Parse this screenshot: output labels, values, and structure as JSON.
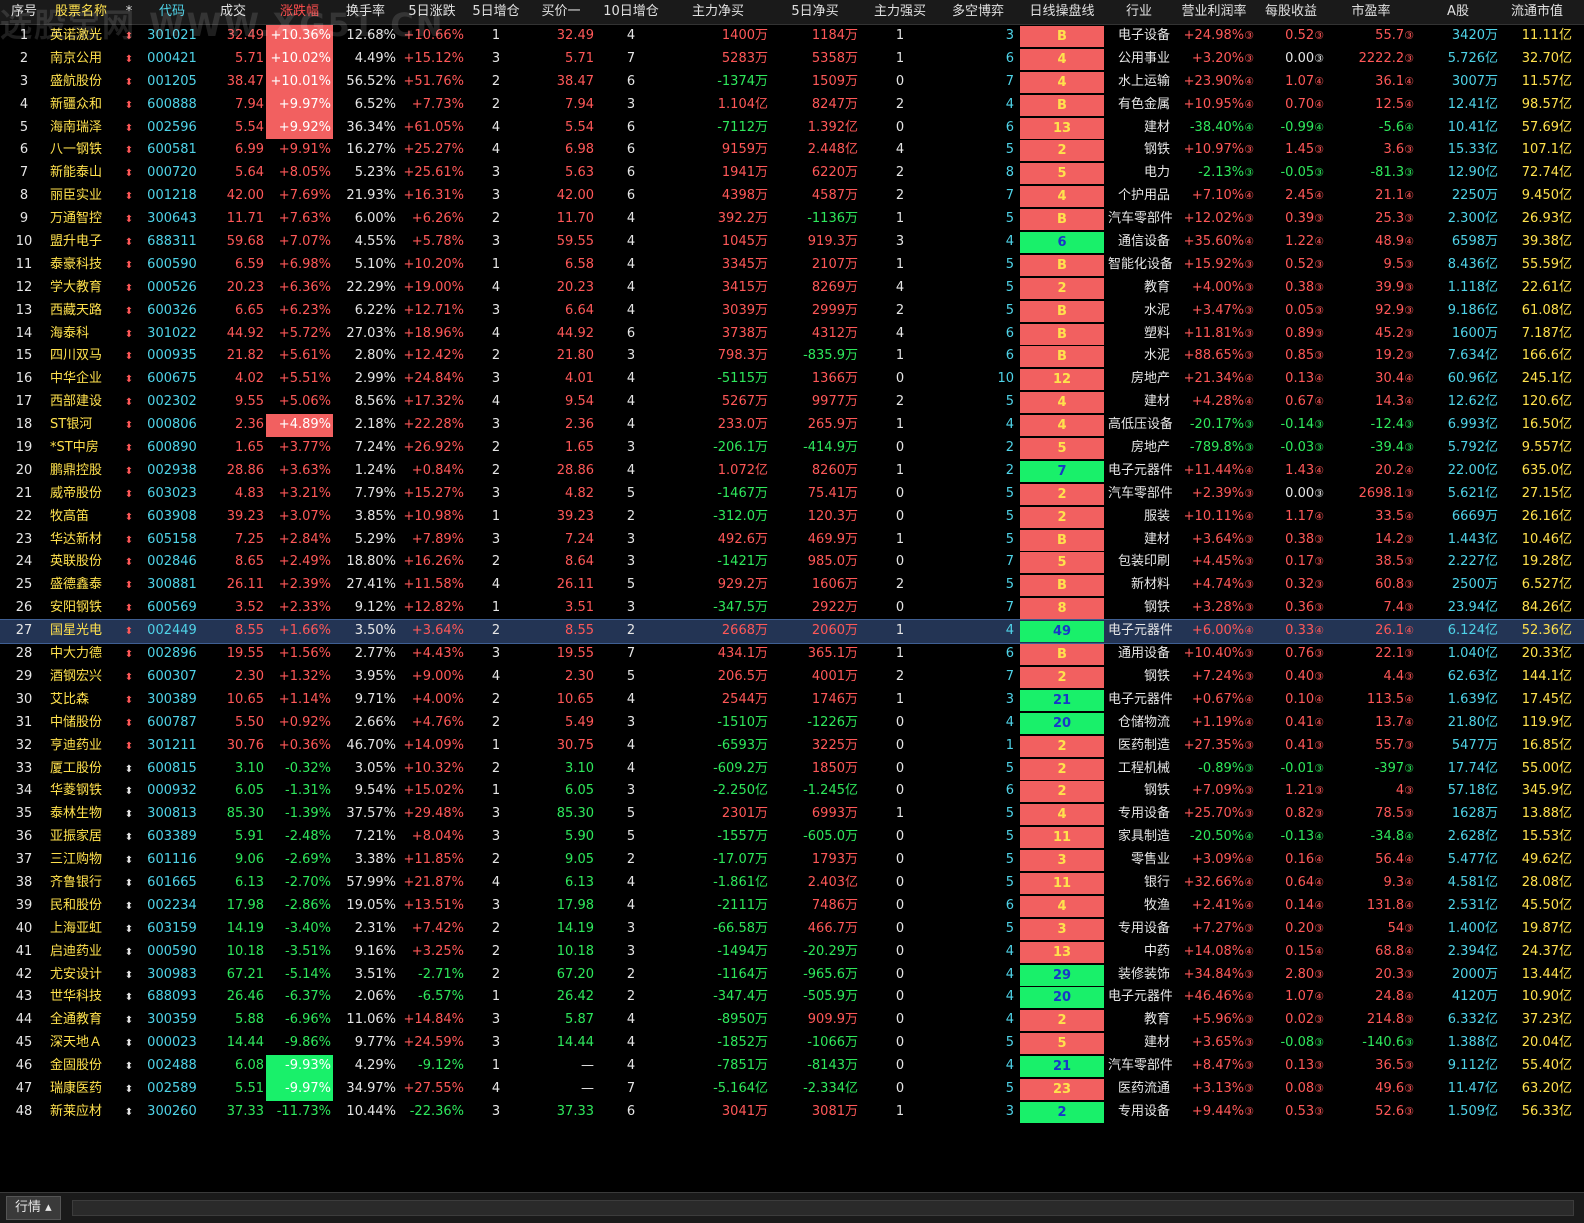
{
  "columns": [
    "序号",
    "股票名称",
    "*",
    "代码",
    "成交",
    "涨跌幅",
    "换手率",
    "5日涨跌",
    "5日增仓",
    "买价一",
    "10日增仓",
    "主力净买",
    "5日净买",
    "主力强买",
    "多空博弈",
    "日线操盘线",
    "行业",
    "营业利润率",
    "每股收益",
    "市盈率",
    "A股",
    "流通市值"
  ],
  "rows": [
    [
      "1",
      "英诺激光",
      "301021",
      "32.49",
      "+10.36%",
      "12.68%",
      "+10.66%",
      "1",
      "32.49",
      "4",
      "1400万",
      "1184万",
      "1",
      "3",
      "B",
      "red",
      "电子设备",
      "+24.98%",
      "③",
      "0.52",
      "③",
      "55.7",
      "③",
      "3420万",
      "11.11亿",
      "up",
      "hl-up"
    ],
    [
      "2",
      "南京公用",
      "000421",
      "5.71",
      "+10.02%",
      "4.49%",
      "+15.12%",
      "3",
      "5.71",
      "7",
      "5283万",
      "5358万",
      "1",
      "6",
      "4",
      "red",
      "公用事业",
      "+3.20%",
      "③",
      "0.00",
      "③",
      "2222.2",
      "③",
      "5.726亿",
      "32.70亿",
      "up",
      "hl-up"
    ],
    [
      "3",
      "盛航股份",
      "001205",
      "38.47",
      "+10.01%",
      "56.52%",
      "+51.76%",
      "2",
      "38.47",
      "6",
      "-1374万",
      "1509万",
      "0",
      "7",
      "4",
      "red",
      "水上运输",
      "+23.90%",
      "④",
      "1.07",
      "④",
      "36.1",
      "④",
      "3007万",
      "11.57亿",
      "up",
      "hl-up"
    ],
    [
      "4",
      "新疆众和",
      "600888",
      "7.94",
      "+9.97%",
      "6.52%",
      "+7.73%",
      "2",
      "7.94",
      "3",
      "1.104亿",
      "8247万",
      "2",
      "4",
      "B",
      "red",
      "有色金属",
      "+10.95%",
      "④",
      "0.70",
      "④",
      "12.5",
      "④",
      "12.41亿",
      "98.57亿",
      "up",
      "hl-up"
    ],
    [
      "5",
      "海南瑞泽",
      "002596",
      "5.54",
      "+9.92%",
      "36.34%",
      "+61.05%",
      "4",
      "5.54",
      "6",
      "-7112万",
      "1.392亿",
      "0",
      "6",
      "13",
      "red",
      "建材",
      "-38.40%",
      "④",
      "-0.99",
      "④",
      "-5.6",
      "④",
      "10.41亿",
      "57.69亿",
      "up",
      "hl-up"
    ],
    [
      "6",
      "八一钢铁",
      "600581",
      "6.99",
      "+9.91%",
      "16.27%",
      "+25.27%",
      "4",
      "6.98",
      "6",
      "9159万",
      "2.448亿",
      "4",
      "5",
      "2",
      "red",
      "钢铁",
      "+10.97%",
      "③",
      "1.45",
      "③",
      "3.6",
      "③",
      "15.33亿",
      "107.1亿",
      "up",
      ""
    ],
    [
      "7",
      "新能泰山",
      "000720",
      "5.64",
      "+8.05%",
      "5.23%",
      "+25.61%",
      "3",
      "5.63",
      "6",
      "1941万",
      "6220万",
      "2",
      "8",
      "5",
      "red",
      "电力",
      "-2.13%",
      "③",
      "-0.05",
      "③",
      "-81.3",
      "③",
      "12.90亿",
      "72.74亿",
      "up",
      ""
    ],
    [
      "8",
      "丽臣实业",
      "001218",
      "42.00",
      "+7.69%",
      "21.93%",
      "+16.31%",
      "3",
      "42.00",
      "6",
      "4398万",
      "4587万",
      "2",
      "7",
      "4",
      "red",
      "个护用品",
      "+7.10%",
      "④",
      "2.45",
      "④",
      "21.1",
      "④",
      "2250万",
      "9.450亿",
      "up",
      ""
    ],
    [
      "9",
      "万通智控",
      "300643",
      "11.71",
      "+7.63%",
      "6.00%",
      "+6.26%",
      "2",
      "11.70",
      "4",
      "392.2万",
      "-1136万",
      "1",
      "5",
      "B",
      "red",
      "汽车零部件",
      "+12.02%",
      "③",
      "0.39",
      "③",
      "25.3",
      "③",
      "2.300亿",
      "26.93亿",
      "up",
      ""
    ],
    [
      "10",
      "盟升电子",
      "688311",
      "59.68",
      "+7.07%",
      "4.55%",
      "+5.78%",
      "3",
      "59.55",
      "4",
      "1045万",
      "919.3万",
      "3",
      "4",
      "6",
      "green",
      "通信设备",
      "+35.60%",
      "④",
      "1.22",
      "④",
      "48.9",
      "④",
      "6598万",
      "39.38亿",
      "up",
      ""
    ],
    [
      "11",
      "泰豪科技",
      "600590",
      "6.59",
      "+6.98%",
      "5.10%",
      "+10.20%",
      "1",
      "6.58",
      "4",
      "3345万",
      "2107万",
      "1",
      "5",
      "B",
      "red",
      "智能化设备",
      "+15.92%",
      "③",
      "0.52",
      "③",
      "9.5",
      "③",
      "8.436亿",
      "55.59亿",
      "up",
      ""
    ],
    [
      "12",
      "学大教育",
      "000526",
      "20.23",
      "+6.36%",
      "22.29%",
      "+19.00%",
      "4",
      "20.23",
      "4",
      "3415万",
      "8269万",
      "4",
      "5",
      "2",
      "red",
      "教育",
      "+4.00%",
      "③",
      "0.38",
      "③",
      "39.9",
      "③",
      "1.118亿",
      "22.61亿",
      "up",
      ""
    ],
    [
      "13",
      "西藏天路",
      "600326",
      "6.65",
      "+6.23%",
      "6.22%",
      "+12.71%",
      "3",
      "6.64",
      "4",
      "3039万",
      "2999万",
      "2",
      "5",
      "B",
      "red",
      "水泥",
      "+3.47%",
      "③",
      "0.05",
      "③",
      "92.9",
      "③",
      "9.186亿",
      "61.08亿",
      "up",
      ""
    ],
    [
      "14",
      "海泰科",
      "301022",
      "44.92",
      "+5.72%",
      "27.03%",
      "+18.96%",
      "4",
      "44.92",
      "6",
      "3738万",
      "4312万",
      "4",
      "6",
      "B",
      "red",
      "塑料",
      "+11.81%",
      "③",
      "0.89",
      "③",
      "45.2",
      "③",
      "1600万",
      "7.187亿",
      "up",
      ""
    ],
    [
      "15",
      "四川双马",
      "000935",
      "21.82",
      "+5.61%",
      "2.80%",
      "+12.42%",
      "2",
      "21.80",
      "3",
      "798.3万",
      "-835.9万",
      "1",
      "6",
      "B",
      "red",
      "水泥",
      "+88.65%",
      "③",
      "0.85",
      "③",
      "19.2",
      "③",
      "7.634亿",
      "166.6亿",
      "up",
      ""
    ],
    [
      "16",
      "中华企业",
      "600675",
      "4.02",
      "+5.51%",
      "2.99%",
      "+24.84%",
      "3",
      "4.01",
      "4",
      "-5115万",
      "1366万",
      "0",
      "10",
      "12",
      "red",
      "房地产",
      "+21.34%",
      "④",
      "0.13",
      "④",
      "30.4",
      "④",
      "60.96亿",
      "245.1亿",
      "up",
      ""
    ],
    [
      "17",
      "西部建设",
      "002302",
      "9.55",
      "+5.06%",
      "8.56%",
      "+17.32%",
      "4",
      "9.54",
      "4",
      "5267万",
      "9977万",
      "2",
      "5",
      "4",
      "red",
      "建材",
      "+4.28%",
      "④",
      "0.67",
      "④",
      "14.3",
      "④",
      "12.62亿",
      "120.6亿",
      "up",
      ""
    ],
    [
      "18",
      "ST银河",
      "000806",
      "2.36",
      "+4.89%",
      "2.18%",
      "+22.28%",
      "3",
      "2.36",
      "4",
      "233.0万",
      "265.9万",
      "1",
      "4",
      "4",
      "red",
      "高低压设备",
      "-20.17%",
      "③",
      "-0.14",
      "③",
      "-12.4",
      "③",
      "6.993亿",
      "16.50亿",
      "up",
      "hl-up"
    ],
    [
      "19",
      "*ST中房",
      "600890",
      "1.65",
      "+3.77%",
      "7.24%",
      "+26.92%",
      "2",
      "1.65",
      "3",
      "-206.1万",
      "-414.9万",
      "0",
      "2",
      "5",
      "red",
      "房地产",
      "-789.8%",
      "③",
      "-0.03",
      "③",
      "-39.4",
      "③",
      "5.792亿",
      "9.557亿",
      "up",
      ""
    ],
    [
      "20",
      "鹏鼎控股",
      "002938",
      "28.86",
      "+3.63%",
      "1.24%",
      "+0.84%",
      "2",
      "28.86",
      "4",
      "1.072亿",
      "8260万",
      "1",
      "2",
      "7",
      "green",
      "电子元器件",
      "+11.44%",
      "④",
      "1.43",
      "④",
      "20.2",
      "④",
      "22.00亿",
      "635.0亿",
      "up",
      ""
    ],
    [
      "21",
      "威帝股份",
      "603023",
      "4.83",
      "+3.21%",
      "7.79%",
      "+15.27%",
      "3",
      "4.82",
      "5",
      "-1467万",
      "75.41万",
      "0",
      "5",
      "2",
      "red",
      "汽车零部件",
      "+2.39%",
      "③",
      "0.00",
      "③",
      "2698.1",
      "③",
      "5.621亿",
      "27.15亿",
      "up",
      ""
    ],
    [
      "22",
      "牧高笛",
      "603908",
      "39.23",
      "+3.07%",
      "3.85%",
      "+10.98%",
      "1",
      "39.23",
      "2",
      "-312.0万",
      "120.3万",
      "0",
      "5",
      "2",
      "red",
      "服装",
      "+10.11%",
      "④",
      "1.17",
      "④",
      "33.5",
      "④",
      "6669万",
      "26.16亿",
      "up",
      ""
    ],
    [
      "23",
      "华达新材",
      "605158",
      "7.25",
      "+2.84%",
      "5.29%",
      "+7.89%",
      "3",
      "7.24",
      "3",
      "492.6万",
      "469.9万",
      "1",
      "5",
      "B",
      "red",
      "建材",
      "+3.64%",
      "③",
      "0.38",
      "③",
      "14.2",
      "③",
      "1.443亿",
      "10.46亿",
      "up",
      ""
    ],
    [
      "24",
      "英联股份",
      "002846",
      "8.65",
      "+2.49%",
      "18.80%",
      "+16.26%",
      "2",
      "8.64",
      "3",
      "-1421万",
      "985.0万",
      "0",
      "7",
      "5",
      "red",
      "包装印刷",
      "+4.45%",
      "③",
      "0.17",
      "③",
      "38.5",
      "③",
      "2.227亿",
      "19.28亿",
      "up",
      ""
    ],
    [
      "25",
      "盛德鑫泰",
      "300881",
      "26.11",
      "+2.39%",
      "27.41%",
      "+11.58%",
      "4",
      "26.11",
      "5",
      "929.2万",
      "1606万",
      "2",
      "5",
      "B",
      "red",
      "新材料",
      "+4.74%",
      "③",
      "0.32",
      "③",
      "60.8",
      "③",
      "2500万",
      "6.527亿",
      "up",
      ""
    ],
    [
      "26",
      "安阳钢铁",
      "600569",
      "3.52",
      "+2.33%",
      "9.12%",
      "+12.82%",
      "1",
      "3.51",
      "3",
      "-347.5万",
      "2922万",
      "0",
      "7",
      "8",
      "red",
      "钢铁",
      "+3.28%",
      "③",
      "0.36",
      "③",
      "7.4",
      "③",
      "23.94亿",
      "84.26亿",
      "up",
      ""
    ],
    [
      "27",
      "国星光电",
      "002449",
      "8.55",
      "+1.66%",
      "3.50%",
      "+3.64%",
      "2",
      "8.55",
      "2",
      "2668万",
      "2060万",
      "1",
      "4",
      "49",
      "green",
      "电子元器件",
      "+6.00%",
      "④",
      "0.33",
      "④",
      "26.1",
      "④",
      "6.124亿",
      "52.36亿",
      "up",
      ""
    ],
    [
      "28",
      "中大力德",
      "002896",
      "19.55",
      "+1.56%",
      "2.77%",
      "+4.43%",
      "3",
      "19.55",
      "7",
      "434.1万",
      "365.1万",
      "1",
      "6",
      "B",
      "red",
      "通用设备",
      "+10.40%",
      "③",
      "0.76",
      "③",
      "22.1",
      "③",
      "1.040亿",
      "20.33亿",
      "up",
      ""
    ],
    [
      "29",
      "酒钢宏兴",
      "600307",
      "2.30",
      "+1.32%",
      "3.95%",
      "+9.00%",
      "4",
      "2.30",
      "5",
      "206.5万",
      "4001万",
      "2",
      "7",
      "2",
      "red",
      "钢铁",
      "+7.24%",
      "③",
      "0.40",
      "③",
      "4.4",
      "③",
      "62.63亿",
      "144.1亿",
      "up",
      ""
    ],
    [
      "30",
      "艾比森",
      "300389",
      "10.65",
      "+1.14%",
      "9.71%",
      "+4.00%",
      "2",
      "10.65",
      "4",
      "2544万",
      "1746万",
      "1",
      "3",
      "21",
      "green",
      "电子元器件",
      "+0.67%",
      "④",
      "0.10",
      "④",
      "113.5",
      "④",
      "1.639亿",
      "17.45亿",
      "up",
      ""
    ],
    [
      "31",
      "中储股份",
      "600787",
      "5.50",
      "+0.92%",
      "2.66%",
      "+4.76%",
      "2",
      "5.49",
      "3",
      "-1510万",
      "-1226万",
      "0",
      "4",
      "20",
      "green",
      "仓储物流",
      "+1.19%",
      "④",
      "0.41",
      "④",
      "13.7",
      "④",
      "21.80亿",
      "119.9亿",
      "up",
      ""
    ],
    [
      "32",
      "亨迪药业",
      "301211",
      "30.76",
      "+0.36%",
      "46.70%",
      "+14.09%",
      "1",
      "30.75",
      "4",
      "-6593万",
      "3225万",
      "0",
      "1",
      "2",
      "red",
      "医药制造",
      "+27.35%",
      "③",
      "0.41",
      "③",
      "55.7",
      "③",
      "5477万",
      "16.85亿",
      "up",
      ""
    ],
    [
      "33",
      "厦工股份",
      "600815",
      "3.10",
      "-0.32%",
      "3.05%",
      "+10.32%",
      "2",
      "3.10",
      "4",
      "-609.2万",
      "1850万",
      "0",
      "5",
      "2",
      "red",
      "工程机械",
      "-0.89%",
      "③",
      "-0.01",
      "③",
      "-397",
      "③",
      "17.74亿",
      "55.00亿",
      "dn",
      ""
    ],
    [
      "34",
      "华菱钢铁",
      "000932",
      "6.05",
      "-1.31%",
      "9.54%",
      "+15.02%",
      "1",
      "6.05",
      "3",
      "-2.250亿",
      "-1.245亿",
      "0",
      "6",
      "2",
      "red",
      "钢铁",
      "+7.09%",
      "③",
      "1.21",
      "③",
      "4",
      "③",
      "57.18亿",
      "345.9亿",
      "dn",
      ""
    ],
    [
      "35",
      "泰林生物",
      "300813",
      "85.30",
      "-1.39%",
      "37.57%",
      "+29.48%",
      "3",
      "85.30",
      "5",
      "2301万",
      "6993万",
      "1",
      "5",
      "4",
      "red",
      "专用设备",
      "+25.70%",
      "③",
      "0.82",
      "③",
      "78.5",
      "③",
      "1628万",
      "13.88亿",
      "dn",
      ""
    ],
    [
      "36",
      "亚振家居",
      "603389",
      "5.91",
      "-2.48%",
      "7.21%",
      "+8.04%",
      "3",
      "5.90",
      "5",
      "-1557万",
      "-605.0万",
      "0",
      "5",
      "11",
      "red",
      "家具制造",
      "-20.50%",
      "④",
      "-0.13",
      "④",
      "-34.8",
      "④",
      "2.628亿",
      "15.53亿",
      "dn",
      ""
    ],
    [
      "37",
      "三江购物",
      "601116",
      "9.06",
      "-2.69%",
      "3.38%",
      "+11.85%",
      "2",
      "9.05",
      "2",
      "-17.07万",
      "1793万",
      "0",
      "5",
      "3",
      "red",
      "零售业",
      "+3.09%",
      "④",
      "0.16",
      "④",
      "56.4",
      "④",
      "5.477亿",
      "49.62亿",
      "dn",
      ""
    ],
    [
      "38",
      "齐鲁银行",
      "601665",
      "6.13",
      "-2.70%",
      "57.99%",
      "+21.87%",
      "4",
      "6.13",
      "4",
      "-1.861亿",
      "2.403亿",
      "0",
      "5",
      "11",
      "red",
      "银行",
      "+32.66%",
      "④",
      "0.64",
      "④",
      "9.3",
      "④",
      "4.581亿",
      "28.08亿",
      "dn",
      ""
    ],
    [
      "39",
      "民和股份",
      "002234",
      "17.98",
      "-2.86%",
      "19.05%",
      "+13.51%",
      "3",
      "17.98",
      "4",
      "-2111万",
      "7486万",
      "0",
      "6",
      "4",
      "red",
      "牧渔",
      "+2.41%",
      "④",
      "0.14",
      "④",
      "131.8",
      "④",
      "2.531亿",
      "45.50亿",
      "dn",
      ""
    ],
    [
      "40",
      "上海亚虹",
      "603159",
      "14.19",
      "-3.40%",
      "2.31%",
      "+7.42%",
      "2",
      "14.19",
      "3",
      "-66.58万",
      "466.7万",
      "0",
      "5",
      "3",
      "red",
      "专用设备",
      "+7.27%",
      "③",
      "0.20",
      "③",
      "54",
      "③",
      "1.400亿",
      "19.87亿",
      "dn",
      ""
    ],
    [
      "41",
      "启迪药业",
      "000590",
      "10.18",
      "-3.51%",
      "9.16%",
      "+3.25%",
      "2",
      "10.18",
      "3",
      "-1494万",
      "-20.29万",
      "0",
      "4",
      "13",
      "red",
      "中药",
      "+14.08%",
      "④",
      "0.15",
      "④",
      "68.8",
      "④",
      "2.394亿",
      "24.37亿",
      "dn",
      ""
    ],
    [
      "42",
      "尤安设计",
      "300983",
      "67.21",
      "-5.14%",
      "3.51%",
      "-2.71%",
      "2",
      "67.20",
      "2",
      "-1164万",
      "-965.6万",
      "0",
      "4",
      "29",
      "green",
      "装修装饰",
      "+34.84%",
      "③",
      "2.80",
      "③",
      "20.3",
      "③",
      "2000万",
      "13.44亿",
      "dn",
      ""
    ],
    [
      "43",
      "世华科技",
      "688093",
      "26.46",
      "-6.37%",
      "2.06%",
      "-6.57%",
      "1",
      "26.42",
      "2",
      "-347.4万",
      "-505.9万",
      "0",
      "4",
      "20",
      "green",
      "电子元器件",
      "+46.46%",
      "④",
      "1.07",
      "④",
      "24.8",
      "④",
      "4120万",
      "10.90亿",
      "dn",
      ""
    ],
    [
      "44",
      "全通教育",
      "300359",
      "5.88",
      "-6.96%",
      "11.06%",
      "+14.84%",
      "3",
      "5.87",
      "4",
      "-8950万",
      "909.9万",
      "0",
      "4",
      "2",
      "red",
      "教育",
      "+5.96%",
      "③",
      "0.02",
      "③",
      "214.8",
      "③",
      "6.332亿",
      "37.23亿",
      "dn",
      ""
    ],
    [
      "45",
      "深天地Ａ",
      "000023",
      "14.44",
      "-9.86%",
      "9.77%",
      "+24.59%",
      "3",
      "14.44",
      "4",
      "-1852万",
      "-1066万",
      "0",
      "5",
      "5",
      "red",
      "建材",
      "+3.65%",
      "③",
      "-0.08",
      "③",
      "-140.6",
      "③",
      "1.388亿",
      "20.04亿",
      "dn",
      ""
    ],
    [
      "46",
      "金固股份",
      "002488",
      "6.08",
      "-9.93%",
      "4.29%",
      "-9.12%",
      "1",
      "—",
      "4",
      "-7851万",
      "-8143万",
      "0",
      "4",
      "21",
      "green",
      "汽车零部件",
      "+8.47%",
      "③",
      "0.13",
      "③",
      "36.5",
      "③",
      "9.112亿",
      "55.40亿",
      "dn",
      "hl-dn"
    ],
    [
      "47",
      "瑞康医药",
      "002589",
      "5.51",
      "-9.97%",
      "34.97%",
      "+27.55%",
      "4",
      "—",
      "7",
      "-5.164亿",
      "-2.334亿",
      "0",
      "5",
      "23",
      "red",
      "医药流通",
      "+3.13%",
      "③",
      "0.08",
      "③",
      "49.6",
      "③",
      "11.47亿",
      "63.20亿",
      "dn",
      "hl-dn"
    ],
    [
      "48",
      "新莱应材",
      "300260",
      "37.33",
      "-11.73%",
      "10.44%",
      "-22.36%",
      "3",
      "37.33",
      "6",
      "3041万",
      "3081万",
      "1",
      "3",
      "2",
      "green",
      "专用设备",
      "+9.44%",
      "③",
      "0.53",
      "③",
      "52.6",
      "③",
      "1.509亿",
      "56.33亿",
      "dn",
      ""
    ]
  ],
  "selected_row": 27,
  "footer": {
    "tab_label": "行情"
  },
  "watermark": "选股宝网 WWW.XG51.CN"
}
